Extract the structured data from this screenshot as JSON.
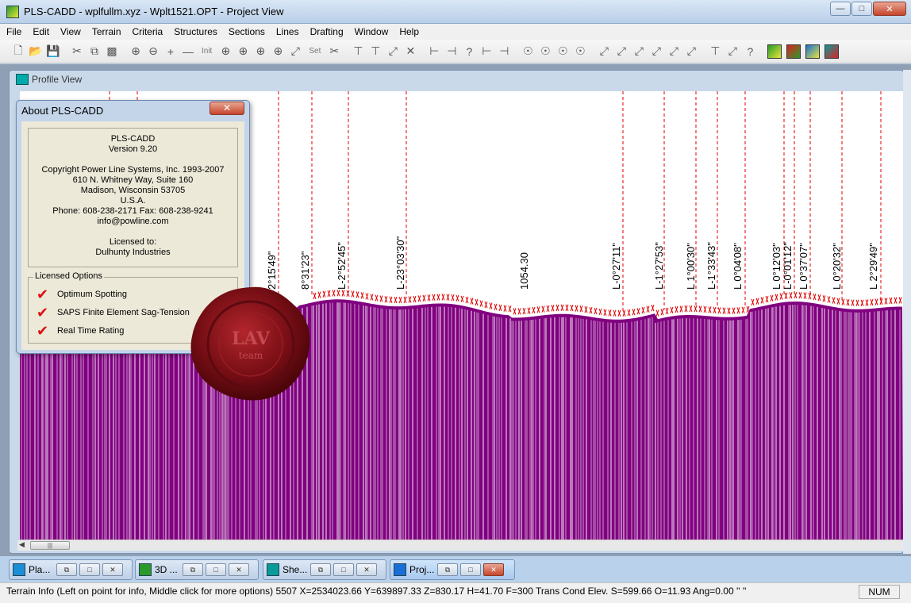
{
  "window": {
    "title": "PLS-CADD - wplfullm.xyz - Wplt1521.OPT - Project View",
    "controls": [
      "minimize",
      "maximize",
      "close"
    ]
  },
  "menu": [
    "File",
    "Edit",
    "View",
    "Terrain",
    "Criteria",
    "Structures",
    "Sections",
    "Lines",
    "Drafting",
    "Window",
    "Help"
  ],
  "toolbar": {
    "init_label": "Init",
    "set_label": "Set"
  },
  "profile_view": {
    "title": "Profile View",
    "structure_labels": [
      "2°15'49\"",
      "8°31'23\"",
      "L-2°52'45\"",
      "L-23°03'30\"",
      "1054.30",
      "L-0°27'11\"",
      "L-1°27'53\"",
      "L 1°00'30\"",
      "L-1°33'43\"",
      "L 0°04'08\"",
      "L 0°12'03\"",
      "L-0°01'12\"",
      "L 0°37'07\"",
      "L 0°20'32\"",
      "L 2°29'49\""
    ]
  },
  "about": {
    "title": "About PLS-CADD",
    "product": "PLS-CADD",
    "version": "Version 9.20",
    "copyright": "Copyright Power Line Systems, Inc. 1993-2007",
    "address1": "610 N. Whitney Way, Suite 160",
    "address2": "Madison, Wisconsin 53705",
    "country": "U.S.A.",
    "phone": "Phone: 608-238-2171 Fax: 608-238-9241",
    "email": "info@powline.com",
    "licensed_to_label": "Licensed to:",
    "licensee": "Dulhunty Industries",
    "options_label": "Licensed Options",
    "options": [
      "Optimum Spotting",
      "SAPS Finite Element Sag-Tension",
      "Real Time Rating"
    ]
  },
  "seal": {
    "text": "LAV",
    "subtext": "team"
  },
  "minimized_windows": [
    {
      "label": "Pla...",
      "icon_color": "#1a8fd6"
    },
    {
      "label": "3D ...",
      "icon_color": "#2a9a2a"
    },
    {
      "label": "She...",
      "icon_color": "#0a9a9a"
    },
    {
      "label": "Proj...",
      "icon_color": "#1a6fd6",
      "active": true
    }
  ],
  "status": {
    "text": "Terrain Info (Left on point for info, Middle click for more options) 5507 X=2534023.66 Y=639897.33 Z=830.17 H=41.70 F=300 Trans Cond Elev. S=599.66 O=11.93 Ang=0.00 '' ''",
    "num": "NUM"
  },
  "colors": {
    "terrain_fill": "#800080",
    "structure_line": "#e00000",
    "titlebar": "#c4d5ea"
  }
}
